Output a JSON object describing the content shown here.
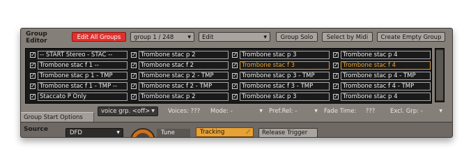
{
  "header": {
    "title_line1": "Group",
    "title_line2": "Editor",
    "edit_all_groups": "Edit All Groups",
    "group_select": "group 1 / 248",
    "edit_select": "Edit",
    "group_solo": "Group Solo",
    "select_by_midi": "Select by Midi",
    "create_empty_group": "Create Empty Group"
  },
  "groups": [
    [
      {
        "name": "-- START Stereo - STAC --",
        "checked": true,
        "selected": false
      },
      {
        "name": "Trombone stac f 1 --",
        "checked": true,
        "selected": false
      },
      {
        "name": "Trombone stac p 1 - TMP",
        "checked": true,
        "selected": false
      },
      {
        "name": "Trombone stac f 1 - TMP --",
        "checked": true,
        "selected": false
      },
      {
        "name": "Staccato P Only",
        "checked": true,
        "selected": false
      }
    ],
    [
      {
        "name": "Trombone stac p 2",
        "checked": true,
        "selected": false
      },
      {
        "name": "Trombone stac f 2",
        "checked": true,
        "selected": false
      },
      {
        "name": "Trombone stac p 2 - TMP",
        "checked": true,
        "selected": false
      },
      {
        "name": "Trombone stac f 2 - TMP",
        "checked": true,
        "selected": false
      },
      {
        "name": "Trombone stac p 2",
        "checked": true,
        "selected": false
      }
    ],
    [
      {
        "name": "Trombone stac p 3",
        "checked": true,
        "selected": false
      },
      {
        "name": "Trombone stac f 3",
        "checked": true,
        "selected": true
      },
      {
        "name": "Trombone stac p 3 - TMP",
        "checked": true,
        "selected": false
      },
      {
        "name": "Trombone stac f 3 - TMP",
        "checked": true,
        "selected": false
      },
      {
        "name": "Trombone stac p 3",
        "checked": true,
        "selected": false
      }
    ],
    [
      {
        "name": "Trombone stac p 4",
        "checked": true,
        "selected": false
      },
      {
        "name": "Trombone stac f 4",
        "checked": true,
        "selected": true
      },
      {
        "name": "Trombone stac p 4 - TMP",
        "checked": true,
        "selected": false
      },
      {
        "name": "Trombone stac f 4 - TMP",
        "checked": true,
        "selected": false
      },
      {
        "name": "Trombone stac p 4",
        "checked": true,
        "selected": false
      }
    ]
  ],
  "options": {
    "tab_label": "Group Start Options",
    "voice_group": "voice grp. <off>",
    "voices_label": "Voices:",
    "voices_value": "???",
    "mode_label": "Mode:",
    "mode_value": "-",
    "pref_rel_label": "Pref.Rel:",
    "pref_rel_value": "-",
    "fade_time_label": "Fade Time:",
    "fade_time_value": "???",
    "excl_grp_label": "Excl. Grp:",
    "excl_grp_value": "-"
  },
  "source": {
    "label": "Source",
    "mode": "DFD",
    "tune_label": "Tune",
    "tracking_label": "Tracking",
    "release_trigger_label": "Release Trigger"
  },
  "colors": {
    "accent_red": "#e0312c",
    "selected_orange": "#e0a030",
    "tracking_orange": "#e6a137"
  },
  "icons": {
    "checkbox": "check-mark",
    "dropdown": "triangle-down",
    "tracking": "curve-icon"
  }
}
